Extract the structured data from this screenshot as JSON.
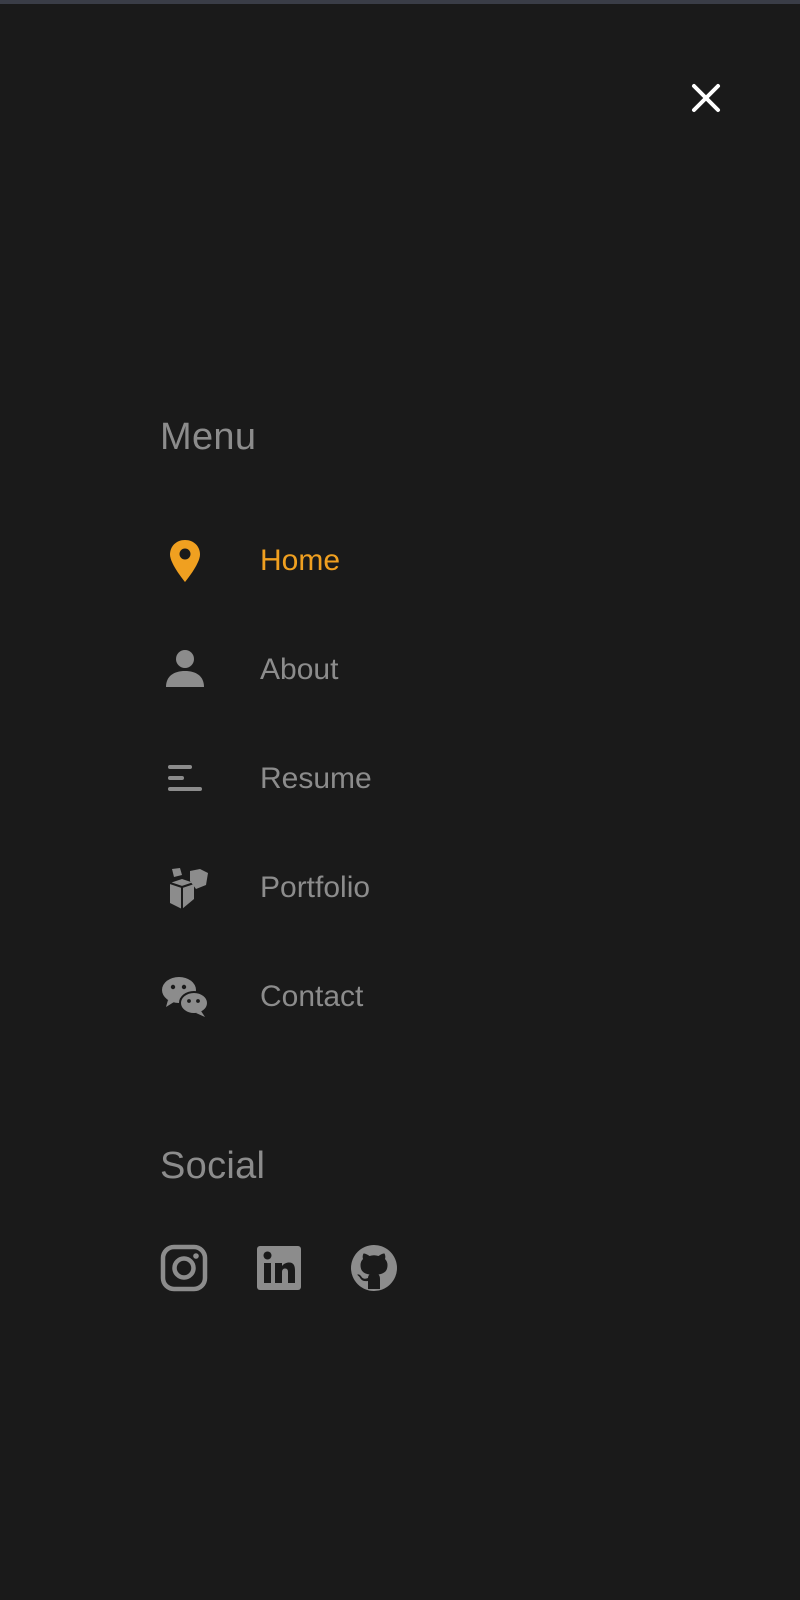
{
  "colors": {
    "background": "#1a1a1a",
    "text_muted": "#8c8c8c",
    "accent": "#f0a020",
    "close_icon": "#ffffff"
  },
  "close": {
    "icon": "close-icon"
  },
  "menu": {
    "heading": "Menu",
    "items": [
      {
        "label": "Home",
        "icon": "map-pin-icon",
        "active": true
      },
      {
        "label": "About",
        "icon": "user-icon",
        "active": false
      },
      {
        "label": "Resume",
        "icon": "align-left-icon",
        "active": false
      },
      {
        "label": "Portfolio",
        "icon": "cubes-icon",
        "active": false
      },
      {
        "label": "Contact",
        "icon": "wechat-icon",
        "active": false
      }
    ]
  },
  "social": {
    "heading": "Social",
    "links": [
      {
        "icon": "instagram-icon"
      },
      {
        "icon": "linkedin-icon"
      },
      {
        "icon": "github-icon"
      }
    ]
  }
}
